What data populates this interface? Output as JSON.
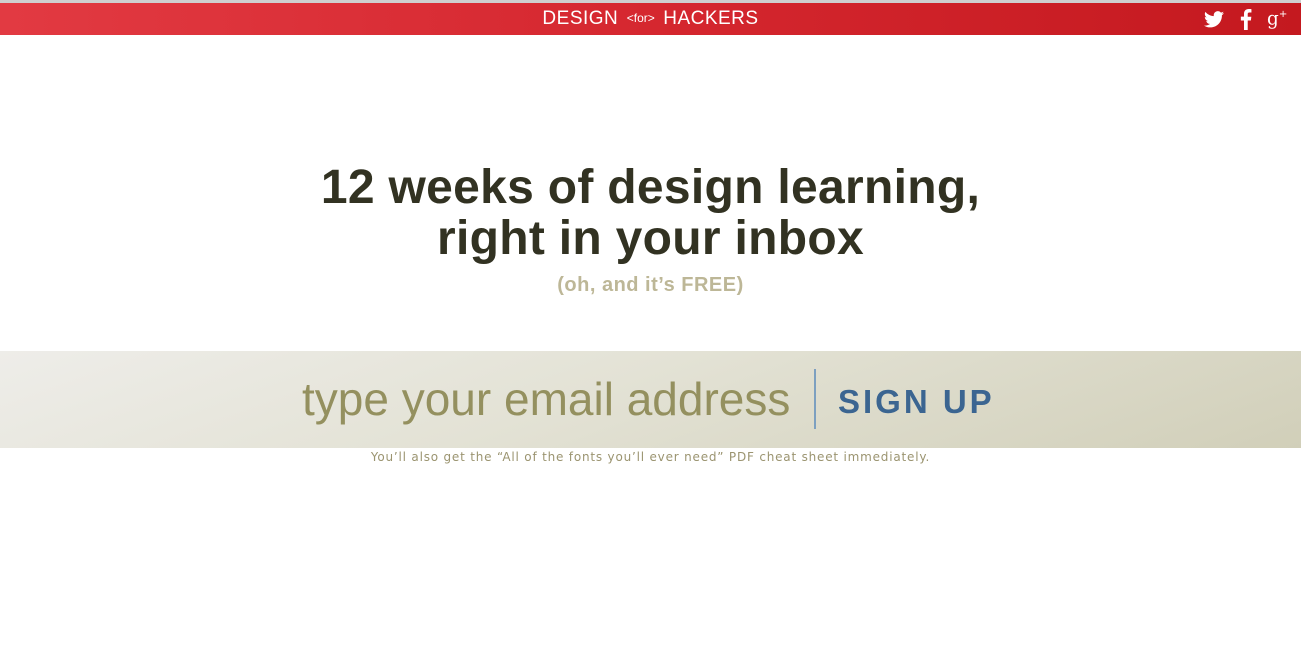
{
  "header": {
    "logo_left": "DESIGN",
    "logo_middle": "<for>",
    "logo_right": "HACKERS",
    "social": [
      "twitter-icon",
      "facebook-icon",
      "google-plus-icon"
    ]
  },
  "hero": {
    "headline_line1": "12 weeks of design learning,",
    "headline_line2": "right in your inbox",
    "subhead": "(oh, and it’s FREE)"
  },
  "signup": {
    "placeholder": "type your email address",
    "value": "",
    "button_label": "SIGN UP",
    "note": "You’ll also get the “All of the fonts you’ll ever need” PDF cheat sheet immediately."
  },
  "colors": {
    "header_red": "#d5272f",
    "headline": "#323222",
    "subhead": "#bdb797",
    "button": "#3b6591",
    "input_text": "#94905f"
  }
}
